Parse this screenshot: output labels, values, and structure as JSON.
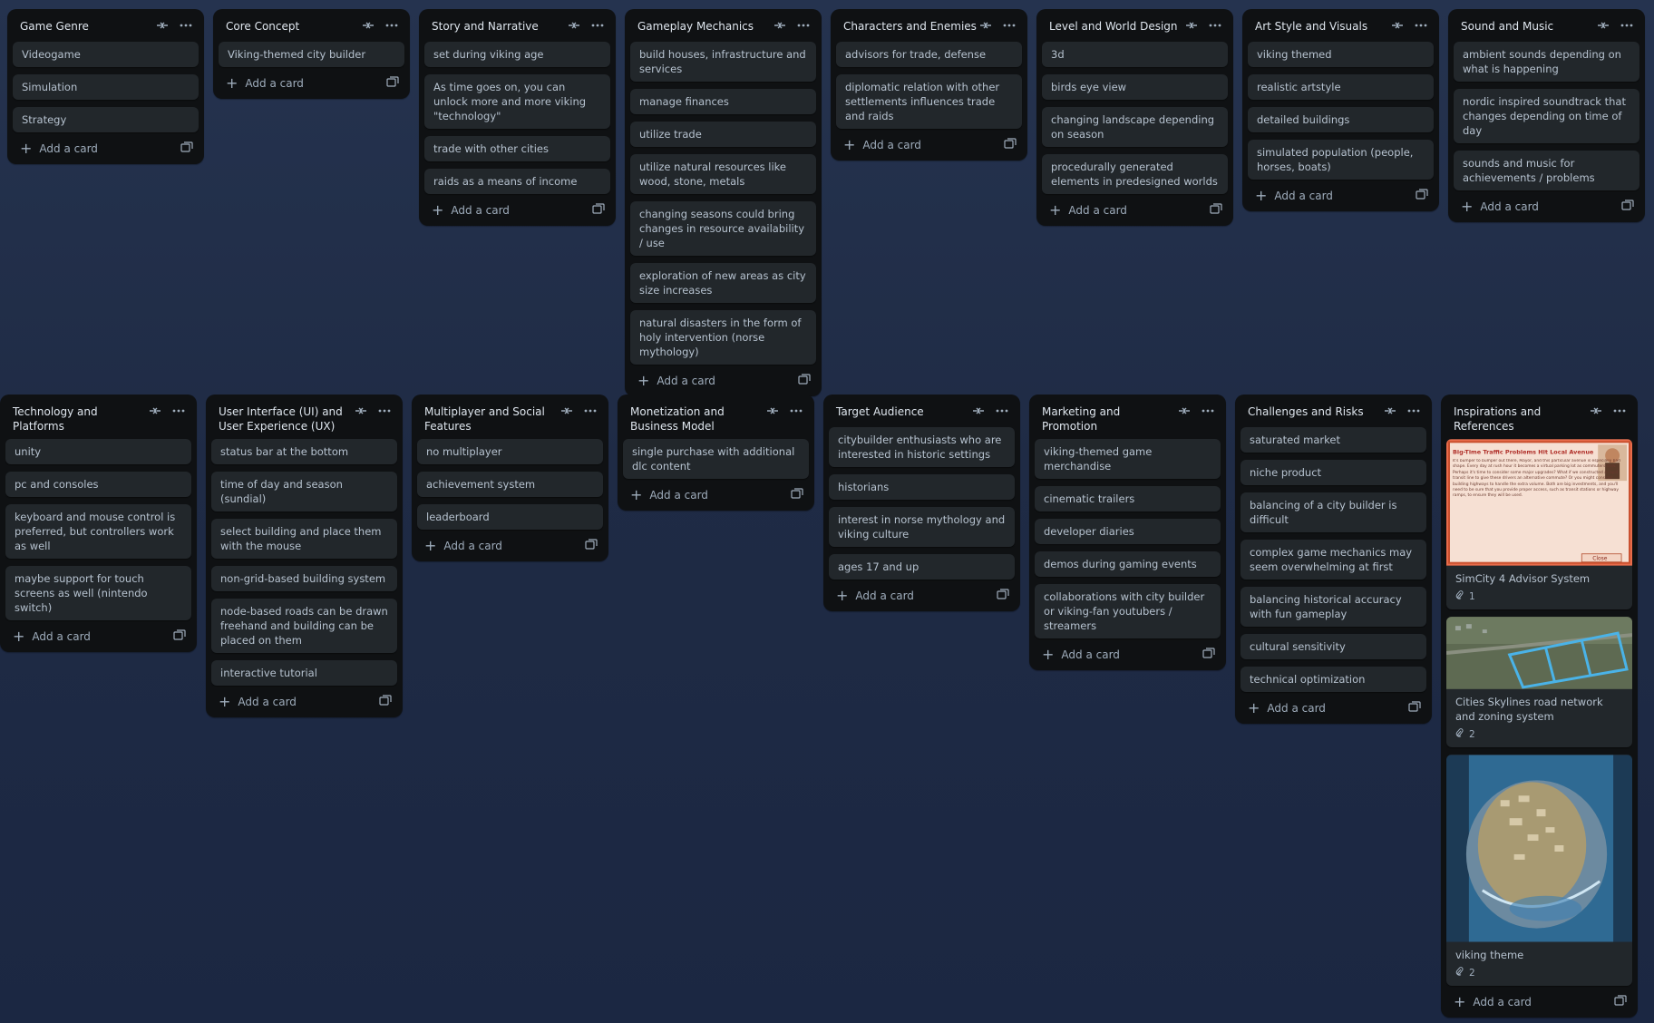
{
  "header_icons": {
    "collapse": "collapse-icon",
    "more": "more-icon"
  },
  "add_card_label": "Add a card",
  "lists_row1": [
    {
      "title": "Game Genre",
      "cards": [
        "Videogame",
        "Simulation",
        "Strategy"
      ]
    },
    {
      "title": "Core Concept",
      "cards": [
        "Viking-themed city builder"
      ]
    },
    {
      "title": "Story and Narrative",
      "cards": [
        "set during viking age",
        "As time goes on, you can unlock more and more viking \"technology\"",
        "trade with other cities",
        "raids as a means of income"
      ]
    },
    {
      "title": "Gameplay Mechanics",
      "cards": [
        "build houses, infrastructure and services",
        "manage finances",
        "utilize trade",
        "utilize natural resources like wood, stone, metals",
        "changing seasons could bring changes in resource availability / use",
        "exploration of new areas as city size increases",
        "natural disasters in the form of holy intervention (norse mythology)"
      ]
    },
    {
      "title": "Characters and Enemies",
      "cards": [
        "advisors for trade, defense",
        "diplomatic relation with other settlements influences trade and raids"
      ]
    },
    {
      "title": "Level and World Design",
      "cards": [
        "3d",
        "birds eye view",
        "changing landscape depending on season",
        "procedurally generated elements in predesigned worlds"
      ]
    },
    {
      "title": "Art Style and Visuals",
      "cards": [
        "viking themed",
        "realistic artstyle",
        "detailed buildings",
        "simulated population (people, horses, boats)"
      ]
    },
    {
      "title": "Sound and Music",
      "cards": [
        "ambient sounds depending on what is happening",
        "nordic inspired soundtrack that changes depending on time of day",
        "sounds and music for achievements / problems"
      ]
    }
  ],
  "lists_row2": [
    {
      "title": "Technology and Platforms",
      "cards": [
        "unity",
        "pc and consoles",
        "keyboard and mouse control is preferred, but controllers work as well",
        "maybe support for touch screens as well (nintendo switch)"
      ]
    },
    {
      "title": "User Interface (UI) and User Experience (UX)",
      "cards": [
        "status bar at the bottom",
        "time of day and season (sundial)",
        "select building and place them with the mouse",
        "non-grid-based building system",
        "node-based roads can be drawn freehand and building can be placed on them",
        "interactive tutorial"
      ]
    },
    {
      "title": "Multiplayer and Social Features",
      "cards": [
        "no multiplayer",
        "achievement system",
        "leaderboard"
      ]
    },
    {
      "title": "Monetization and Business Model",
      "cards": [
        "single purchase with additional dlc content"
      ]
    },
    {
      "title": "Target Audience",
      "cards": [
        "citybuilder enthusiasts who are interested in historic settings",
        "historians",
        "interest in norse mythology and viking culture",
        "ages 17 and up"
      ]
    },
    {
      "title": "Marketing and Promotion",
      "cards": [
        "viking-themed game merchandise",
        "cinematic trailers",
        "developer diaries",
        "demos during gaming events",
        "collaborations with city builder or viking-fan youtubers / streamers"
      ]
    },
    {
      "title": "Challenges and Risks",
      "cards": [
        "saturated market",
        "niche product",
        "balancing of a city builder is difficult",
        "complex game mechanics may seem overwhelming at first",
        "balancing historical accuracy with fun gameplay",
        "cultural sensitivity",
        "technical optimization"
      ]
    }
  ],
  "inspirations": {
    "title": "Inspirations and References",
    "cards": [
      {
        "label": "SimCity 4 Advisor System",
        "attachments": "1",
        "cover_texts": {
          "headline": "Big-Time Traffic Problems Hit Local Avenue",
          "body": "It's bumper to bumper out there, Mayor, and this particular avenue is especially bad shape. Every day at rush hour it becomes a virtual parking lot as commuters slow. Perhaps it's time to consider some major upgrades? What if we constructed a rapid transit line to give these drivers an alternative commute? Or you might consider building highways to handle the extra volume. Both are big investments, and you'll need to be sure that you provide proper access, such as transit stations or highway ramps, to ensure they will be used.",
          "close": "Close"
        }
      },
      {
        "label": "Cities Skylines road network and zoning system",
        "attachments": "2"
      },
      {
        "label": "viking theme",
        "attachments": "2"
      }
    ]
  }
}
